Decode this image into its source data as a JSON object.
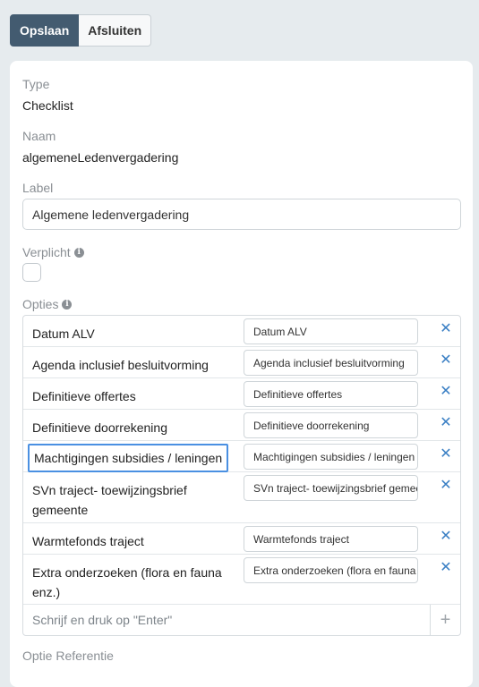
{
  "toolbar": {
    "save_label": "Opslaan",
    "close_label": "Afsluiten"
  },
  "form": {
    "type_label": "Type",
    "type_value": "Checklist",
    "name_label": "Naam",
    "name_value": "algemeneLedenvergadering",
    "label_label": "Label",
    "label_value": "Algemene ledenvergadering",
    "required_label": "Verplicht",
    "required_checked": false,
    "options_label": "Opties",
    "options": [
      {
        "label": "Datum ALV",
        "value": "Datum ALV"
      },
      {
        "label": "Agenda inclusief besluitvorming",
        "value": "Agenda inclusief besluitvorming"
      },
      {
        "label": "Definitieve offertes",
        "value": "Definitieve offertes"
      },
      {
        "label": "Definitieve doorrekening",
        "value": "Definitieve doorrekening"
      },
      {
        "label": "Machtigingen subsidies / leningen",
        "value": "Machtigingen subsidies / leningen",
        "focused": true
      },
      {
        "label": "SVn traject- toewijzingsbrief gemeente",
        "value": "SVn traject- toewijzingsbrief gemeente"
      },
      {
        "label": "Warmtefonds traject",
        "value": "Warmtefonds traject"
      },
      {
        "label": "Extra onderzoeken (flora en fauna enz.)",
        "value": "Extra onderzoeken (flora en fauna enz.)"
      }
    ],
    "add_placeholder": "Schrijf en druk op \"Enter\"",
    "next_label": "Optie Referentie"
  },
  "icons": {
    "info": "info-icon",
    "remove": "close-icon",
    "add": "plus-icon"
  },
  "colors": {
    "primary": "#435b70",
    "accent": "#3a7fc4",
    "focus": "#4a90e2"
  }
}
